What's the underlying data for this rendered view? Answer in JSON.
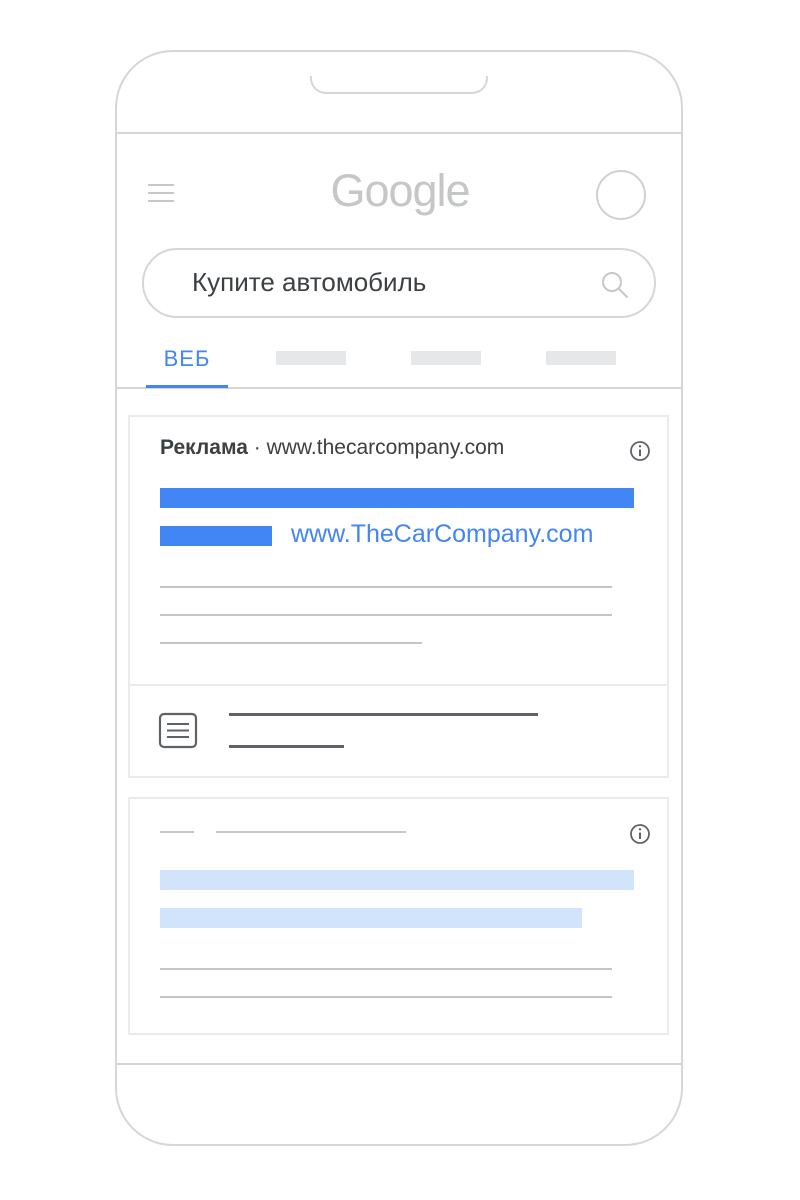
{
  "header": {
    "logo_text": "Google",
    "menu_icon": "hamburger-menu-icon",
    "avatar_icon": "avatar-circle"
  },
  "search": {
    "query": "Купите автомобиль",
    "icon": "search-icon"
  },
  "tabs": [
    {
      "label": "ВЕБ",
      "active": true
    },
    {
      "label": "",
      "active": false
    },
    {
      "label": "",
      "active": false
    },
    {
      "label": "",
      "active": false
    }
  ],
  "ad_card": {
    "ad_label": "Реклама",
    "separator": "·",
    "display_url": "www.thecarcompany.com",
    "headline_url": "www.TheCarCompany.com",
    "info_icon": "info-icon",
    "sitelink_icon": "document-icon"
  },
  "colors": {
    "accent": "#4285f4",
    "accent_light": "#d2e3fc",
    "border": "#d5d6d8",
    "placeholder_line": "#c4c5c7"
  }
}
